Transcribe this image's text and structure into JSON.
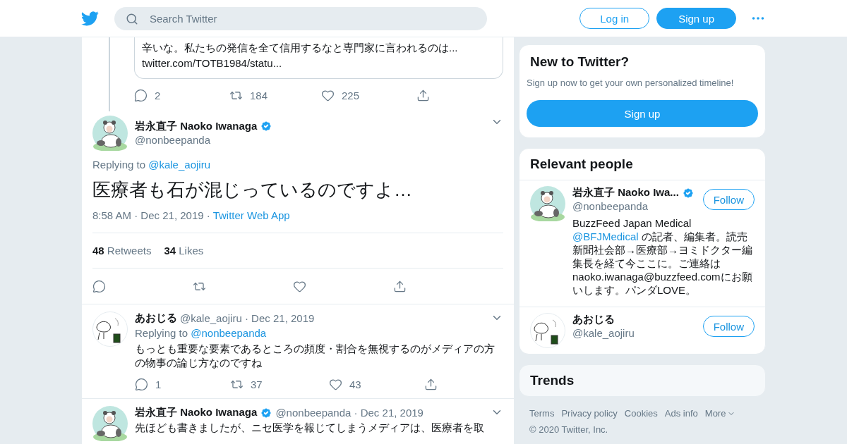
{
  "header": {
    "search_placeholder": "Search Twitter",
    "login": "Log in",
    "signup": "Sign up"
  },
  "quoted": {
    "text": "辛いな。私たちの発信を全て信用するなと専門家に言われるのは...",
    "link": "twitter.com/TOTB1984/statu...",
    "counts": [
      "2",
      "184",
      "225"
    ]
  },
  "main_tweet": {
    "name": "岩永直子 Naoko Iwanaga",
    "verified": true,
    "handle": "@nonbeepanda",
    "replying_label": "Replying to",
    "reply_to": "@kale_aojiru",
    "text": "医療者も石が混じっているのですよ…",
    "timestamp": "8:58 AM · Dec 21, 2019 ·",
    "source": "Twitter Web App",
    "stats": [
      {
        "count": "48",
        "label": "Retweets"
      },
      {
        "count": "34",
        "label": "Likes"
      }
    ]
  },
  "replies": [
    {
      "name": "あおじる",
      "verified": false,
      "meta": "@kale_aojiru · Dec 21, 2019",
      "replying_label": "Replying to",
      "reply_to": "@nonbeepanda",
      "text": "もっとも重要な要素であるところの頻度・割合を無視するのがメディアの方の物事の論じ方なのですね",
      "counts": [
        "1",
        "37",
        "43"
      ]
    },
    {
      "name": "岩永直子 Naoko Iwanaga",
      "verified": true,
      "meta": "@nonbeepanda · Dec 21, 2019",
      "text": "先ほども書きましたが、ニセ医学を報じてしまうメディアは、医療者を取"
    }
  ],
  "signup_card": {
    "title": "New to Twitter?",
    "subtitle": "Sign up now to get your own personalized timeline!",
    "button": "Sign up"
  },
  "relevant_people": {
    "title": "Relevant people",
    "people": [
      {
        "name": "岩永直子 Naoko Iwa...",
        "verified": true,
        "handle": "@nonbeepanda",
        "follow": "Follow",
        "bio_before": "BuzzFeed Japan Medical",
        "bio_link": "@BFJMedical",
        "bio_after": " の記者、編集者。読売新聞社会部→医療部→ヨミドクター編集長を経て今ここに。ご連絡はnaoko.iwanaga@buzzfeed.comにお願いします。パンダLOVE。"
      },
      {
        "name": "あおじる",
        "verified": false,
        "handle": "@kale_aojiru",
        "follow": "Follow"
      }
    ]
  },
  "trends": {
    "title": "Trends"
  },
  "footer": {
    "links": [
      "Terms",
      "Privacy policy",
      "Cookies",
      "Ads info"
    ],
    "more": "More",
    "copyright": "© 2020 Twitter, Inc."
  }
}
